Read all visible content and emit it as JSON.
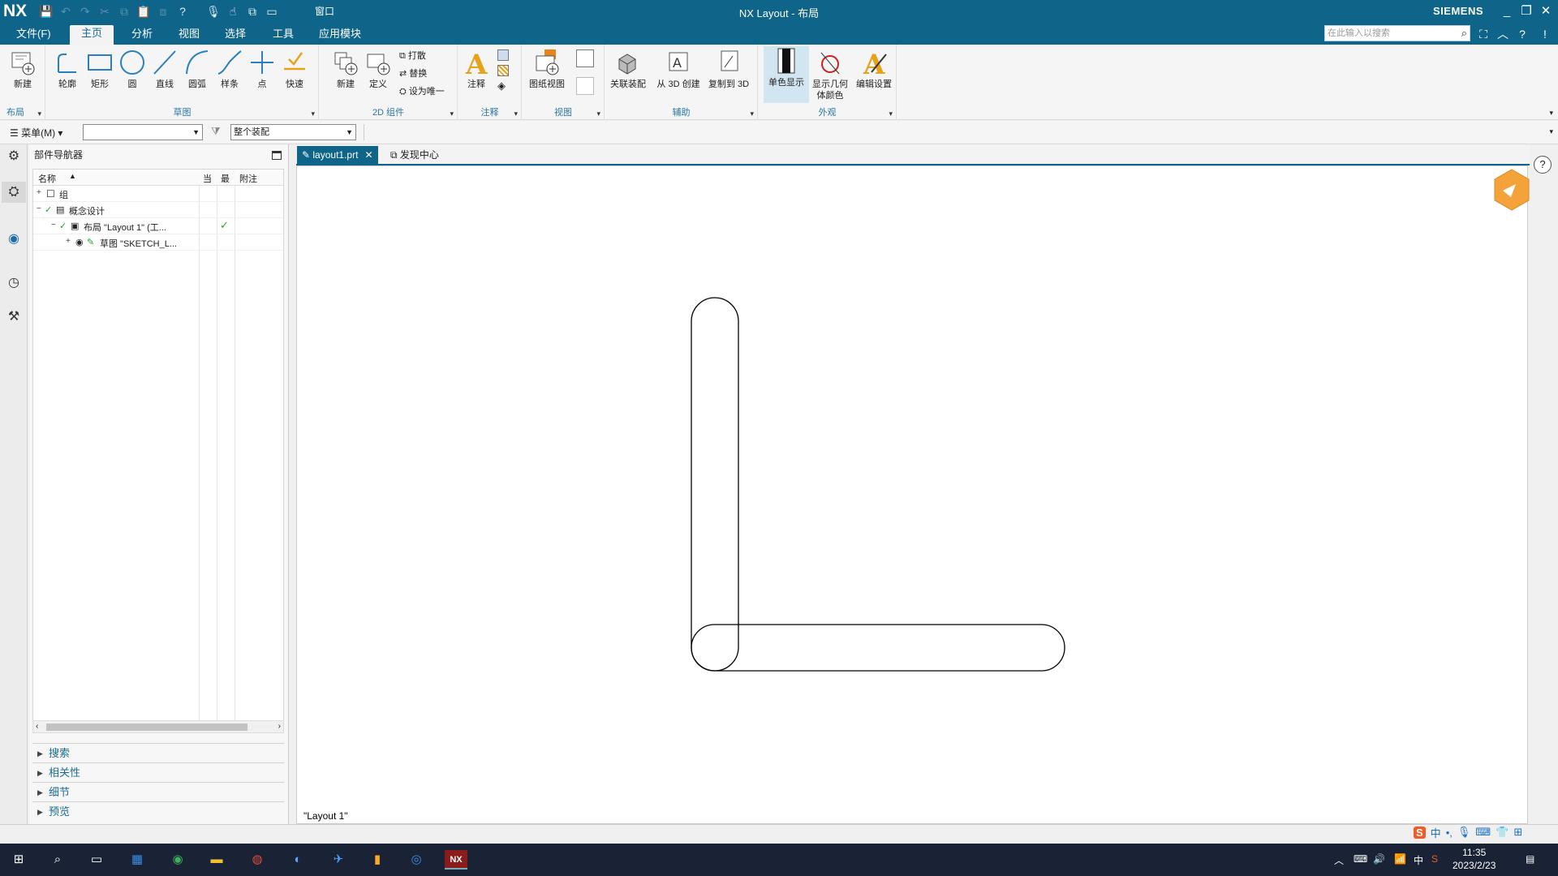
{
  "app": {
    "logo": "NX",
    "window_title": "NX Layout - 布局",
    "brand": "SIEMENS"
  },
  "quick_access": {
    "window_label": "窗口"
  },
  "menu": {
    "file": "文件(F)",
    "tabs": [
      "主页",
      "分析",
      "视图",
      "选择",
      "工具",
      "应用模块"
    ],
    "active_tab": "主页"
  },
  "search": {
    "placeholder": "在此输入以搜索"
  },
  "ribbon": {
    "groups": {
      "layout": "布局",
      "sketch": "草图",
      "comp2d": "2D 组件",
      "annotation": "注释",
      "view": "视图",
      "aux": "辅助",
      "appearance": "外观"
    },
    "layout_tools": [
      "新建"
    ],
    "sketch_tools": [
      "轮廓",
      "矩形",
      "圆",
      "直线",
      "圆弧",
      "样条",
      "点",
      "快速"
    ],
    "comp2d_tools": [
      "新建",
      "定义"
    ],
    "comp2d_small": [
      "打散",
      "替换",
      "设为唯一"
    ],
    "annotation_tools": [
      "注释"
    ],
    "view_tools": [
      "图纸视图"
    ],
    "aux_tools": [
      "关联装配",
      "从 3D 创建",
      "复制到 3D"
    ],
    "appearance_tools": [
      "单色显示",
      "显示几何体颜色",
      "编辑设置"
    ]
  },
  "toolbar": {
    "menu_label": "菜单(M)",
    "filter_value": "",
    "scope_value": "整个装配"
  },
  "navigator": {
    "title": "部件导航器",
    "columns": [
      "名称",
      "当",
      "最",
      "附注"
    ],
    "rows": [
      {
        "name": "组",
        "latest": ""
      },
      {
        "name": "概念设计",
        "latest": ""
      },
      {
        "name": "布局 \"Layout 1\" (工...",
        "latest": "✓"
      },
      {
        "name": "草图 \"SKETCH_L...",
        "latest": ""
      }
    ],
    "panels": [
      "搜索",
      "相关性",
      "细节",
      "预览"
    ]
  },
  "tabs": [
    {
      "label": "layout1.prt",
      "active": true
    },
    {
      "label": "发现中心",
      "active": false
    }
  ],
  "canvas": {
    "label": "\"Layout 1\""
  },
  "taskbar": {
    "time": "11:35",
    "date": "2023/2/23",
    "ime": "中"
  }
}
